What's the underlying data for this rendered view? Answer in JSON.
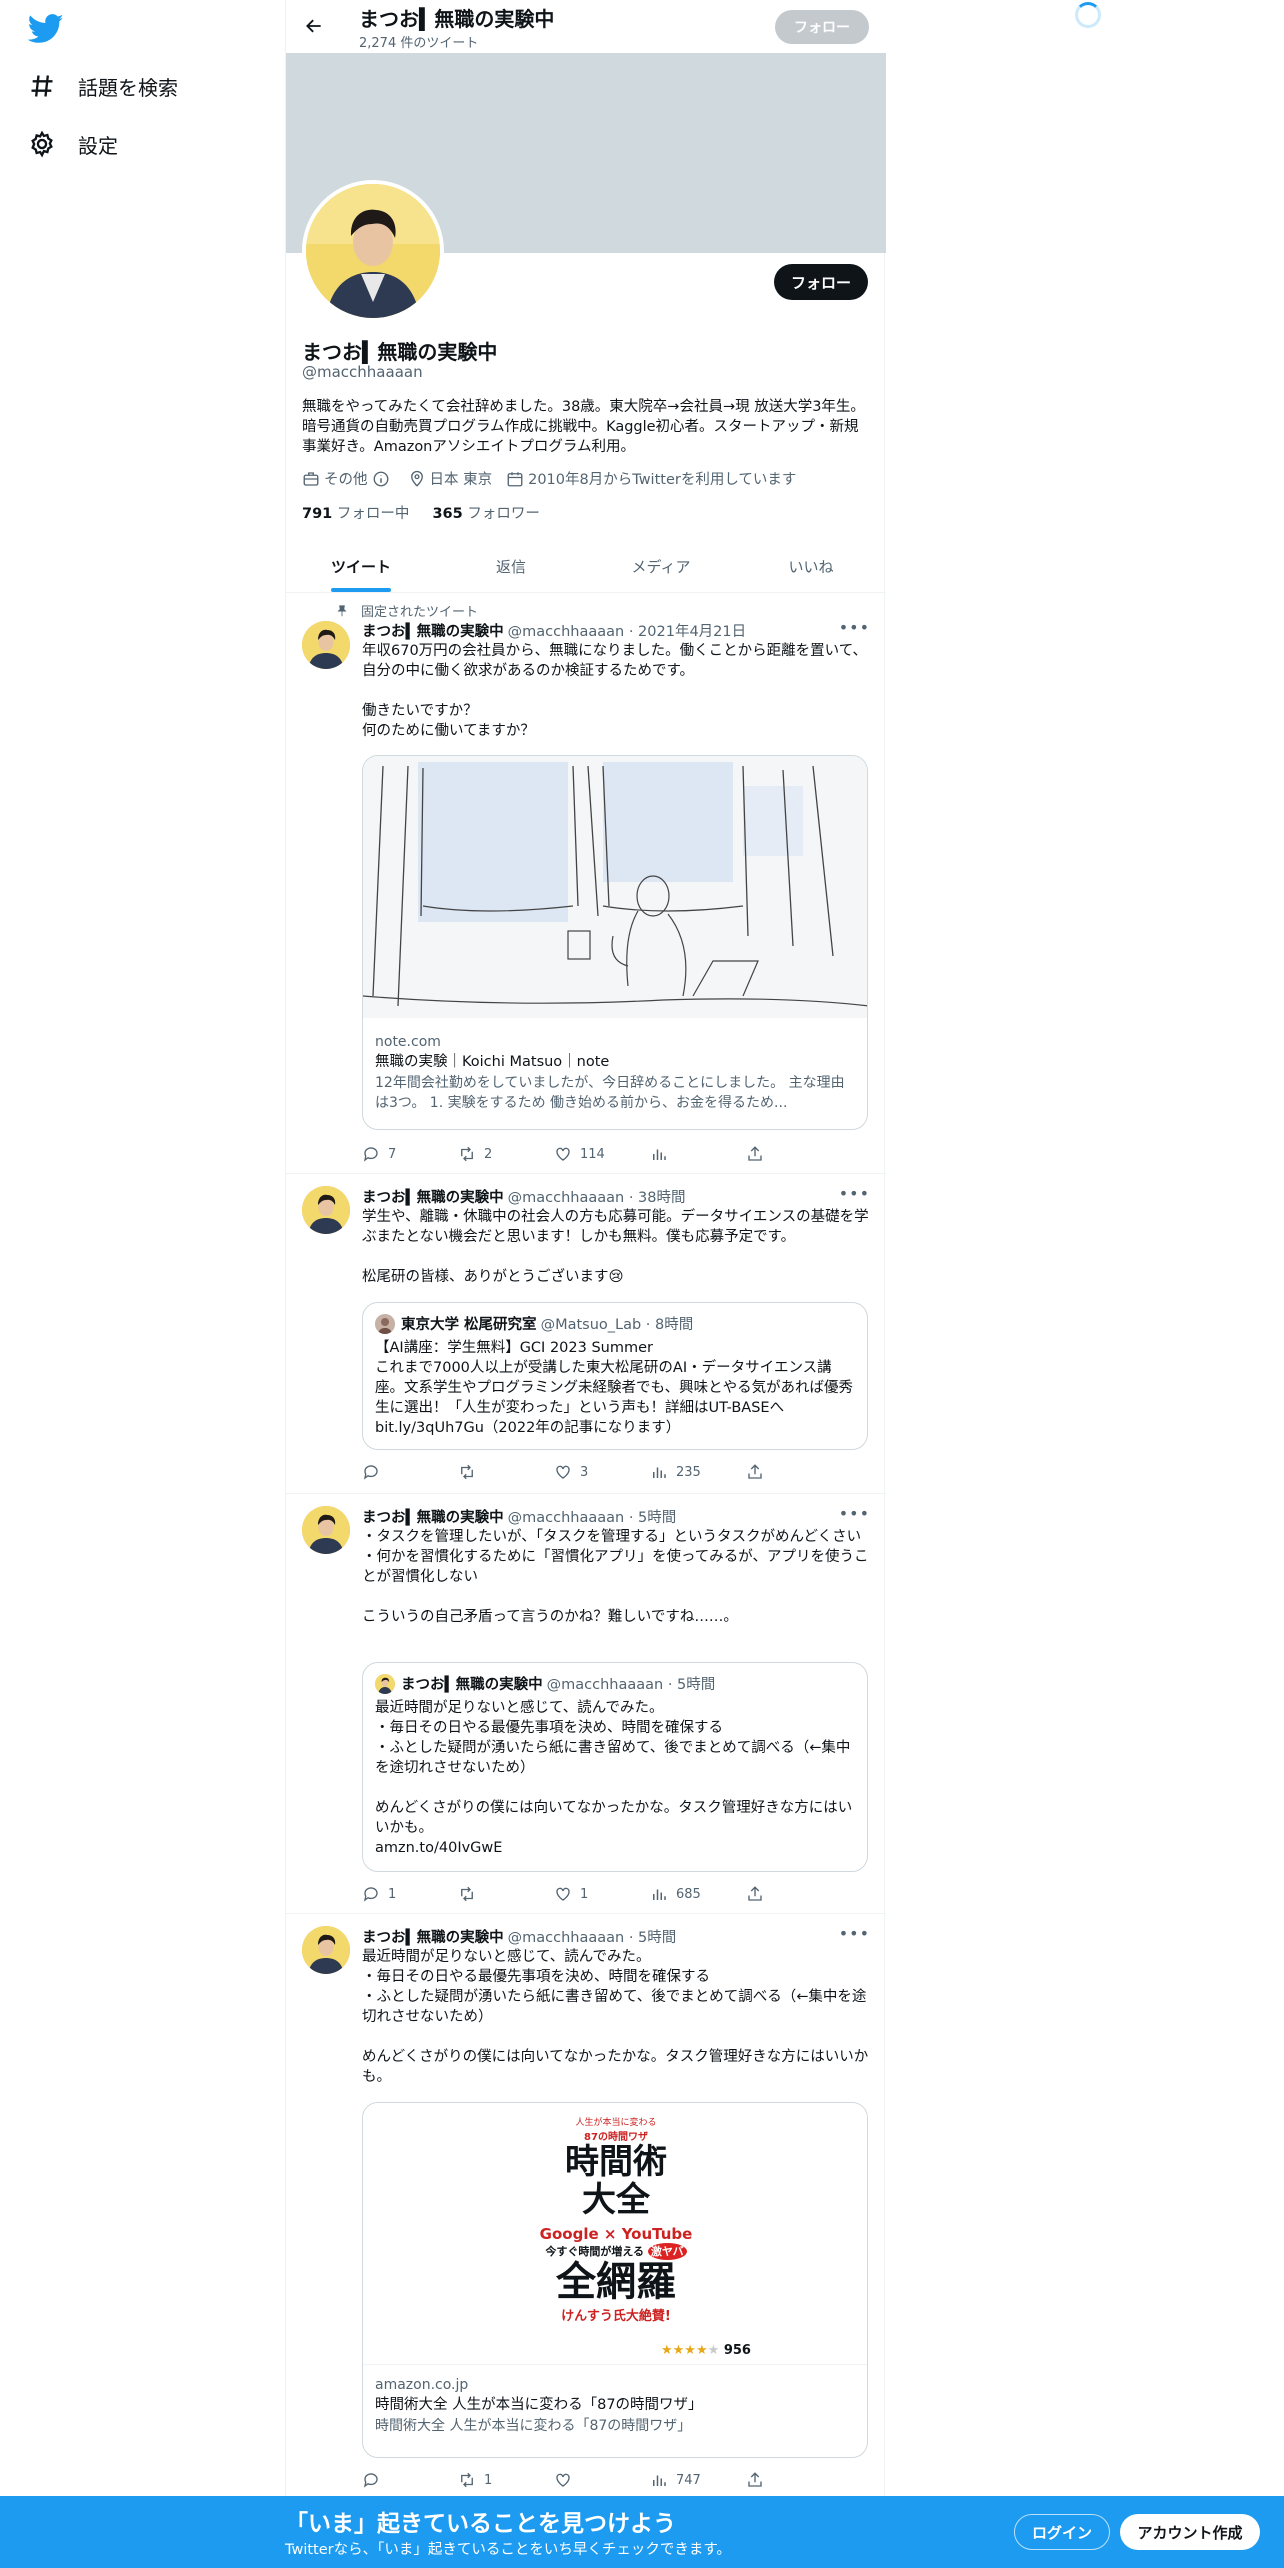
{
  "nav": {
    "explore_label": "話題を検索",
    "settings_label": "設定"
  },
  "header": {
    "name": "まつお▍無職の実験中",
    "tweet_count": "2,274 件のツイート",
    "follow_label": "フォロー"
  },
  "profile": {
    "follow_label": "フォロー",
    "name": "まつお▍無職の実験中",
    "handle": "@macchhaaaan",
    "bio": "無職をやってみたくて会社辞めました。38歳。東大院卒→会社員→現 放送大学3年生。暗号通貨の自動売買プログラム作成に挑戦中。Kaggle初心者。スタートアップ・新規事業好き。Amazonアソシエイトプログラム利用。",
    "category": "その他",
    "location": "日本 東京",
    "joined": "2010年8月からTwitterを利用しています",
    "following_count": "791",
    "following_label": "フォロー中",
    "followers_count": "365",
    "followers_label": "フォロワー"
  },
  "tabs": [
    {
      "label": "ツイート",
      "active": true
    },
    {
      "label": "返信",
      "active": false
    },
    {
      "label": "メディア",
      "active": false
    },
    {
      "label": "いいね",
      "active": false
    }
  ],
  "tweets": [
    {
      "pinned_label": "固定されたツイート",
      "name": "まつお▍無職の実験中",
      "meta": "@macchhaaaan · 2021年4月21日",
      "text": "年収670万円の会社員から、無職になりました。働くことから距離を置いて、自分の中に働く欲求があるのか検証するためです。\n\n働きたいですか？\n何のために働いてますか？",
      "card": {
        "domain": "note.com",
        "title": "無職の実験｜Koichi Matsuo｜note",
        "desc": "12年間会社勤めをしていましたが、今日辞めることにしました。 主な理由は3つ。 1. 実験をするため 働き始める前から、お金を得るため..."
      },
      "replies": "7",
      "retweets": "2",
      "likes": "114",
      "views": ""
    },
    {
      "name": "まつお▍無職の実験中",
      "meta": "@macchhaaaan · 38時間",
      "text": "学生や、離職・休職中の社会人の方も応募可能。データサイエンスの基礎を学ぶまたとない機会だと思います！しかも無料。僕も応募予定です。\n\n松尾研の皆様、ありがとうございます😢",
      "quote": {
        "name": "東京大学 松尾研究室",
        "meta": "@Matsuo_Lab · 8時間",
        "text": "【AI講座：学生無料】GCI 2023 Summer\nこれまで7000人以上が受講した東大松尾研のAI・データサイエンス講座。文系学生やプログラミング未経験者でも、興味とやる気があれば優秀生に選出！「人生が変わった」という声も！詳細はUT-BASEへbit.ly/3qUh7Gu（2022年の記事になります）"
      },
      "replies": "",
      "retweets": "",
      "likes": "3",
      "views": "235"
    },
    {
      "name": "まつお▍無職の実験中",
      "meta": "@macchhaaaan · 5時間",
      "text": "・タスクを管理したいが、「タスクを管理する」というタスクがめんどくさい\n・何かを習慣化するために「習慣化アプリ」を使ってみるが、アプリを使うことが習慣化しない\n\nこういうの自己矛盾って言うのかね？難しいですね……。",
      "quote": {
        "name": "まつお▍無職の実験中",
        "meta": "@macchhaaaan · 5時間",
        "text": "最近時間が足りないと感じて、読んでみた。\n・毎日その日やる最優先事項を決め、時間を確保する\n・ふとした疑問が湧いたら紙に書き留めて、後でまとめて調べる（←集中を途切れさせないため）\n\nめんどくさがりの僕には向いてなかったかな。タスク管理好きな方にはいいかも。\namzn.to/40IvGwE"
      },
      "replies": "1",
      "retweets": "",
      "likes": "1",
      "views": "685"
    },
    {
      "name": "まつお▍無職の実験中",
      "meta": "@macchhaaaan · 5時間",
      "text": "最近時間が足りないと感じて、読んでみた。\n・毎日その日やる最優先事項を決め、時間を確保する\n・ふとした疑問が湧いたら紙に書き留めて、後でまとめて調べる（←集中を途切れさせないため）\n\nめんどくさがりの僕には向いてなかったかな。タスク管理好きな方にはいいかも。",
      "card": {
        "domain": "amazon.co.jp",
        "title": "時間術大全 人生が本当に変わる「87の時間ワザ」",
        "desc": "時間術大全 人生が本当に変わる「87の時間ワザ」"
      },
      "book": {
        "top": "人生が本当に変わる",
        "top2": "87の時間ワザ",
        "title1": "時間術",
        "title2": "大全",
        "google": "Google",
        "youtube": "YouTube",
        "sub": "今すぐ時間が増える",
        "sub2": "激ヤバ",
        "big": "全網羅",
        "bottom": "けんすう氏大絶賛!",
        "reviews": "956"
      },
      "replies": "",
      "retweets": "1",
      "likes": "",
      "views": "747"
    }
  ],
  "bottom_bar": {
    "title": "「いま」起きていることを見つけよう",
    "subtitle": "Twitterなら、「いま」起きていることをいち早くチェックできます。",
    "login_label": "ログイン",
    "signup_label": "アカウント作成"
  },
  "colors": {
    "accent": "#1d9bf0",
    "text": "#0f1419",
    "secondary": "#536471",
    "banner": "#cfd9de"
  }
}
